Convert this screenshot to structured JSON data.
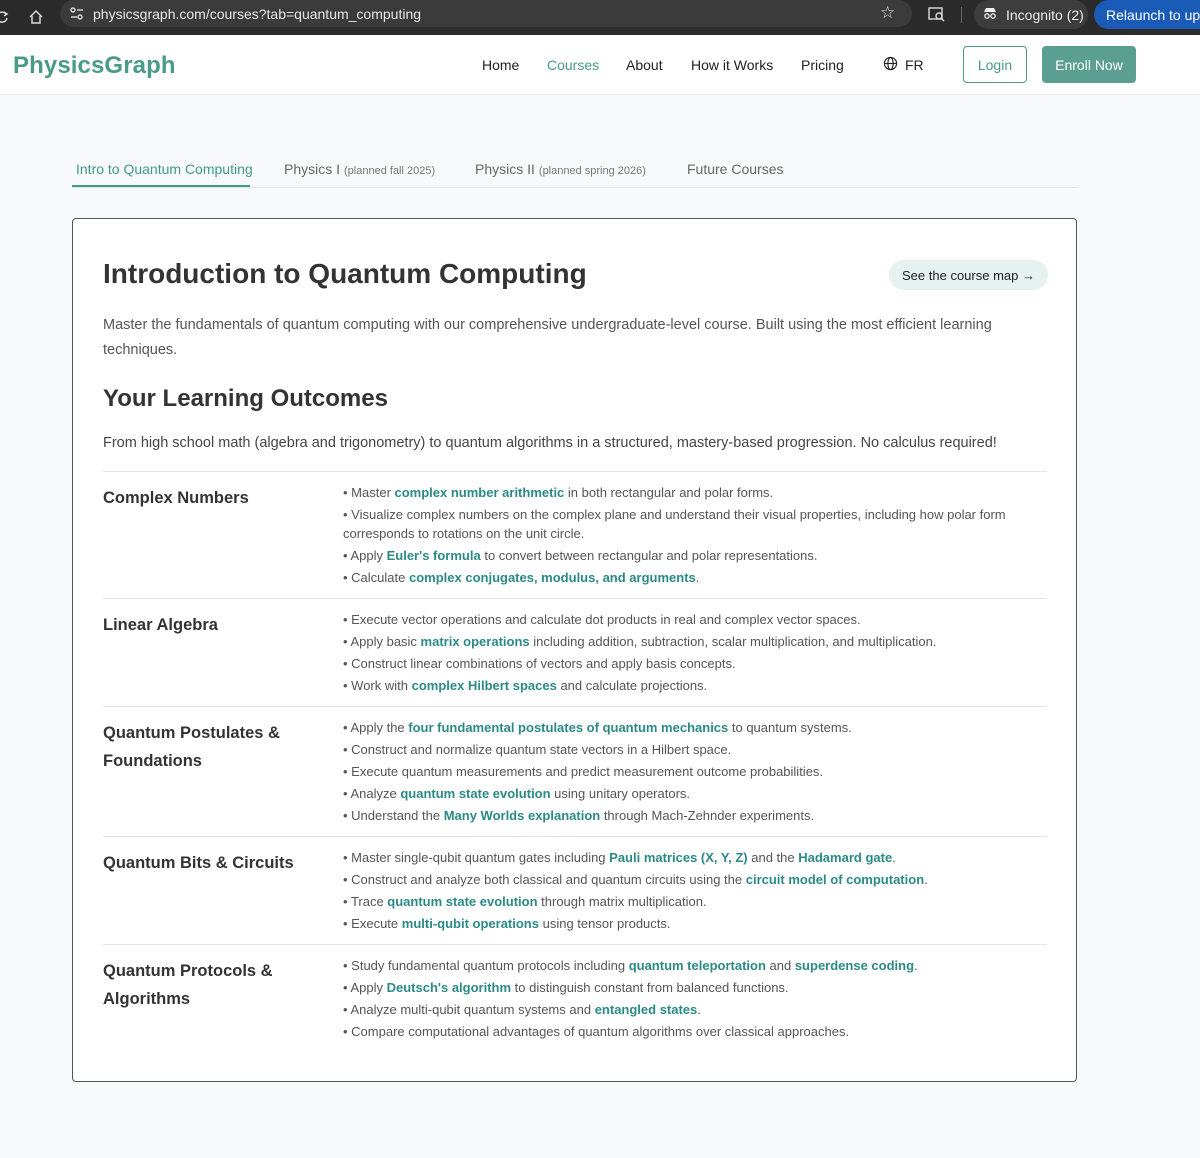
{
  "browser": {
    "url": "physicsgraph.com/courses?tab=quantum_computing",
    "incognito": "Incognito (2)",
    "relaunch": "Relaunch to upda"
  },
  "header": {
    "logo": "PhysicsGraph",
    "nav": [
      "Home",
      "Courses",
      "About",
      "How it Works",
      "Pricing"
    ],
    "active_nav": "Courses",
    "lang": "FR",
    "login": "Login",
    "enroll": "Enroll Now",
    "brand_color": "#4a9a88"
  },
  "tabs": [
    {
      "label": "Intro to Quantum Computing",
      "note": ""
    },
    {
      "label": "Physics I",
      "note": "(planned fall 2025)"
    },
    {
      "label": "Physics II",
      "note": "(planned spring 2026)"
    },
    {
      "label": "Future Courses",
      "note": ""
    }
  ],
  "course": {
    "title": "Introduction to Quantum Computing",
    "map_button": "See the course map →",
    "intro": "Master the fundamentals of quantum computing with our comprehensive undergraduate-level course. Built using the most efficient learning techniques.",
    "outcomes_heading": "Your Learning Outcomes",
    "outcomes_summary": "From high school math (algebra and trigonometry) to quantum algorithms in a structured, mastery-based progression. No calculus required!",
    "sections": [
      {
        "title": "Complex Numbers",
        "items": [
          [
            [
              "Master ",
              false
            ],
            [
              "complex number arithmetic",
              true
            ],
            [
              " in both rectangular and polar forms.",
              false
            ]
          ],
          [
            [
              "Visualize complex numbers on the complex plane and understand their visual properties, including how polar form corresponds to rotations on the unit circle.",
              false
            ]
          ],
          [
            [
              "Apply ",
              false
            ],
            [
              "Euler's formula",
              true
            ],
            [
              " to convert between rectangular and polar representations.",
              false
            ]
          ],
          [
            [
              "Calculate ",
              false
            ],
            [
              "complex conjugates, modulus, and arguments",
              true
            ],
            [
              ".",
              false
            ]
          ]
        ]
      },
      {
        "title": "Linear Algebra",
        "items": [
          [
            [
              "Execute vector operations and calculate dot products in real and complex vector spaces.",
              false
            ]
          ],
          [
            [
              "Apply basic ",
              false
            ],
            [
              "matrix operations",
              true
            ],
            [
              " including addition, subtraction, scalar multiplication, and multiplication.",
              false
            ]
          ],
          [
            [
              "Construct linear combinations of vectors and apply basis concepts.",
              false
            ]
          ],
          [
            [
              "Work with ",
              false
            ],
            [
              "complex Hilbert spaces",
              true
            ],
            [
              " and calculate projections.",
              false
            ]
          ]
        ]
      },
      {
        "title": "Quantum Postulates & Foundations",
        "items": [
          [
            [
              "Apply the ",
              false
            ],
            [
              "four fundamental postulates of quantum mechanics",
              true
            ],
            [
              " to quantum systems.",
              false
            ]
          ],
          [
            [
              "Construct and normalize quantum state vectors in a Hilbert space.",
              false
            ]
          ],
          [
            [
              "Execute quantum measurements and predict measurement outcome probabilities.",
              false
            ]
          ],
          [
            [
              "Analyze ",
              false
            ],
            [
              "quantum state evolution",
              true
            ],
            [
              " using unitary operators.",
              false
            ]
          ],
          [
            [
              "Understand the ",
              false
            ],
            [
              "Many Worlds explanation",
              true
            ],
            [
              " through Mach-Zehnder experiments.",
              false
            ]
          ]
        ]
      },
      {
        "title": "Quantum Bits & Circuits",
        "items": [
          [
            [
              "Master single-qubit quantum gates including ",
              false
            ],
            [
              "Pauli matrices (X, Y, Z)",
              true
            ],
            [
              " and the ",
              false
            ],
            [
              "Hadamard gate",
              true
            ],
            [
              ".",
              false
            ]
          ],
          [
            [
              "Construct and analyze both classical and quantum circuits using the ",
              false
            ],
            [
              "circuit model of computation",
              true
            ],
            [
              ".",
              false
            ]
          ],
          [
            [
              "Trace ",
              false
            ],
            [
              "quantum state evolution",
              true
            ],
            [
              " through matrix multiplication.",
              false
            ]
          ],
          [
            [
              "Execute ",
              false
            ],
            [
              "multi-qubit operations",
              true
            ],
            [
              " using tensor products.",
              false
            ]
          ]
        ]
      },
      {
        "title": "Quantum Protocols & Algorithms",
        "items": [
          [
            [
              "Study fundamental quantum protocols including ",
              false
            ],
            [
              "quantum teleportation",
              true
            ],
            [
              " and ",
              false
            ],
            [
              "superdense coding",
              true
            ],
            [
              ".",
              false
            ]
          ],
          [
            [
              "Apply ",
              false
            ],
            [
              "Deutsch's algorithm",
              true
            ],
            [
              " to distinguish constant from balanced functions.",
              false
            ]
          ],
          [
            [
              "Analyze multi-qubit quantum systems and ",
              false
            ],
            [
              "entangled states",
              true
            ],
            [
              ".",
              false
            ]
          ],
          [
            [
              "Compare computational advantages of quantum algorithms over classical approaches.",
              false
            ]
          ]
        ]
      }
    ]
  }
}
